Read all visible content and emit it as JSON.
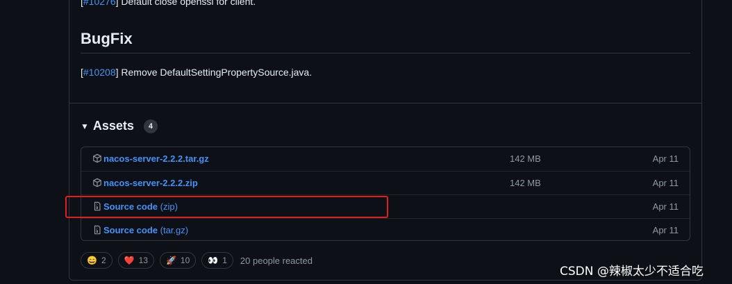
{
  "notes": {
    "prev_issue_open": "[",
    "prev_issue_link": "#10276",
    "prev_issue_text": "] Default close openssl for client.",
    "heading": "BugFix",
    "fix_issue_open": "[",
    "fix_issue_link": "#10208",
    "fix_issue_text": "] Remove DefaultSettingPropertySource.java."
  },
  "assets": {
    "title": "Assets",
    "count": "4",
    "items": [
      {
        "name": "nacos-server-2.2.2.tar.gz",
        "ext": "",
        "size": "142 MB",
        "date": "Apr 11",
        "icon": "package-icon"
      },
      {
        "name": "nacos-server-2.2.2.zip",
        "ext": "",
        "size": "142 MB",
        "date": "Apr 11",
        "icon": "package-icon"
      },
      {
        "name": "Source code",
        "ext": " (zip)",
        "size": "",
        "date": "Apr 11",
        "icon": "file-zip-icon"
      },
      {
        "name": "Source code",
        "ext": " (tar.gz)",
        "size": "",
        "date": "Apr 11",
        "icon": "file-zip-icon"
      }
    ]
  },
  "reactions": {
    "items": [
      {
        "emoji": "😄",
        "count": "2"
      },
      {
        "emoji": "❤️",
        "count": "13"
      },
      {
        "emoji": "🚀",
        "count": "10"
      },
      {
        "emoji": "👀",
        "count": "1"
      }
    ],
    "summary": "20 people reacted"
  },
  "watermark": "CSDN @辣椒太少不适合吃"
}
